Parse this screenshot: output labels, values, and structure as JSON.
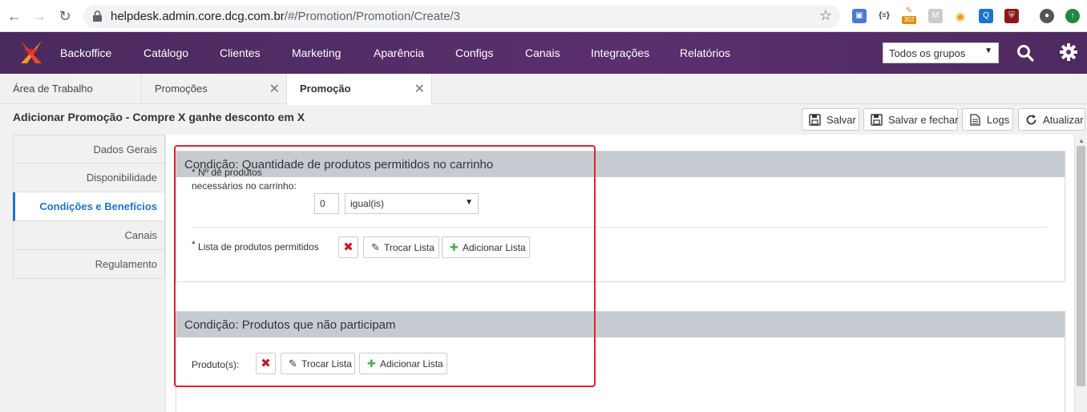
{
  "browser": {
    "url_host": "helpdesk.admin.core.dcg.com.br",
    "url_path": "/#/Promotion/Promotion/Create/3",
    "ext_badge": "302"
  },
  "appbar": {
    "menu": [
      "Backoffice",
      "Catálogo",
      "Clientes",
      "Marketing",
      "Aparência",
      "Configs",
      "Canais",
      "Integrações",
      "Relatórios"
    ],
    "group_select": "Todos os grupos"
  },
  "tabs": [
    {
      "label": "Área de Trabalho"
    },
    {
      "label": "Promoções"
    },
    {
      "label": "Promoção"
    }
  ],
  "page": {
    "title": "Adicionar Promoção - Compre X ganhe desconto em X",
    "actions": {
      "save": "Salvar",
      "save_close": "Salvar e fechar",
      "logs": "Logs",
      "refresh": "Atualizar"
    }
  },
  "subnav": [
    "Dados Gerais",
    "Disponibilidade",
    "Condições e Benefícios",
    "Canais",
    "Regulamento"
  ],
  "condition1": {
    "title": "Condição: Quantidade de produtos permitidos no carrinho",
    "qty_label_line1": "* Nº de produtos",
    "qty_label_line2": "necessários no carrinho:",
    "qty_value": "0",
    "operator": "igual(is)",
    "list_label": "Lista de produtos permitidos",
    "list_label_star": "*",
    "swap": "Trocar Lista",
    "add": "Adicionar Lista"
  },
  "condition2": {
    "title": "Condição: Produtos que não participam",
    "products_label": "Produto(s):",
    "swap": "Trocar Lista",
    "add": "Adicionar Lista"
  },
  "colors": {
    "appbar": "#5b2f6e",
    "active_link": "#1f73c9",
    "highlight": "#e0242f",
    "panel_header": "#c6cbd1"
  }
}
